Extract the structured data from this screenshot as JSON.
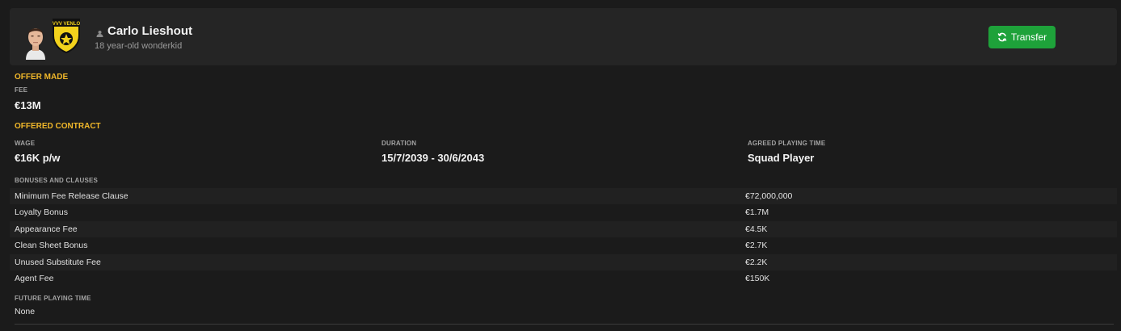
{
  "header": {
    "player_name": "Carlo Lieshout",
    "player_subtitle": "18 year-old wonderkid",
    "club_logo_text": "VVV VENLO",
    "transfer_button_label": "Transfer"
  },
  "offer": {
    "section_title": "OFFER MADE",
    "fee_label": "FEE",
    "fee_value": "€13M"
  },
  "contract": {
    "section_title": "OFFERED CONTRACT",
    "wage_label": "WAGE",
    "wage_value": "€16K p/w",
    "duration_label": "DURATION",
    "duration_value": "15/7/2039 - 30/6/2043",
    "playing_time_label": "AGREED PLAYING TIME",
    "playing_time_value": "Squad Player"
  },
  "bonuses": {
    "label": "BONUSES AND CLAUSES",
    "rows": [
      {
        "name": "Minimum Fee Release Clause",
        "amount": "€72,000,000"
      },
      {
        "name": "Loyalty Bonus",
        "amount": "€1.7M"
      },
      {
        "name": "Appearance Fee",
        "amount": "€4.5K"
      },
      {
        "name": "Clean Sheet Bonus",
        "amount": "€2.7K"
      },
      {
        "name": "Unused Substitute Fee",
        "amount": "€2.2K"
      },
      {
        "name": "Agent Fee",
        "amount": "€150K"
      }
    ]
  },
  "future_playing_time": {
    "label": "FUTURE PLAYING TIME",
    "value": "None"
  },
  "colors": {
    "accent_yellow": "#f1b82a",
    "button_green": "#1ea23a",
    "background": "#1b1b1b",
    "card": "#252525"
  },
  "icons": [
    "person-icon",
    "refresh-icon",
    "club-logo",
    "player-avatar"
  ]
}
